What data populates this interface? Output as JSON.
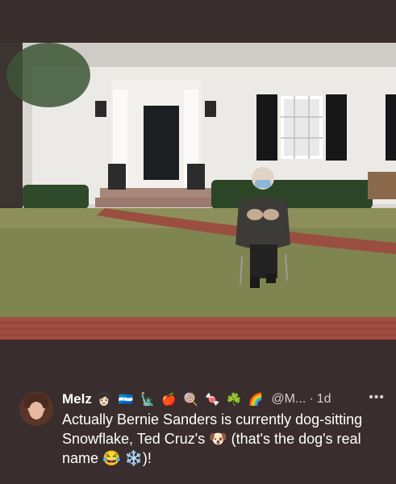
{
  "tweet": {
    "name": "Melz",
    "name_emojis": "👩🏻 🇭🇳 🗽 🍎 🍭 🍬 ☘️ 🌈",
    "handle": "@M...",
    "separator": "·",
    "time": "1d",
    "more": "•••",
    "text": "Actually Bernie Sanders is currently dog-sitting Snowflake, Ted Cruz's 🐶 (that's the dog's real name 😂 ❄️)!"
  },
  "icons": {
    "more": "more-options-icon",
    "avatar": "profile-avatar"
  },
  "colors": {
    "background": "#3a2d2d",
    "text": "#ffffff",
    "secondary_text": "#d8cfcf"
  }
}
